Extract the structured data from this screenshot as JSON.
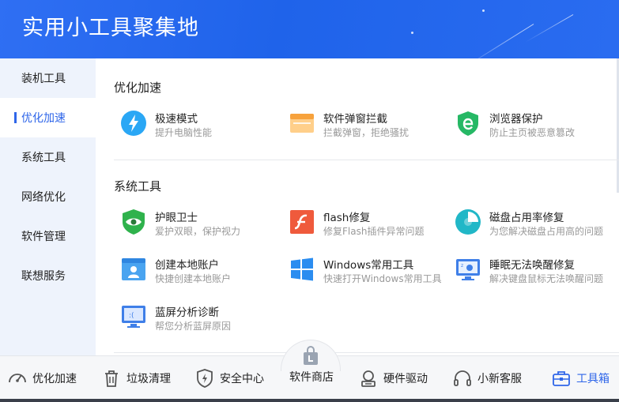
{
  "header": {
    "title": "实用小工具聚集地"
  },
  "sidebar": {
    "items": [
      {
        "label": "装机工具",
        "active": false
      },
      {
        "label": "优化加速",
        "active": true
      },
      {
        "label": "系统工具",
        "active": false
      },
      {
        "label": "网络优化",
        "active": false
      },
      {
        "label": "软件管理",
        "active": false
      },
      {
        "label": "联想服务",
        "active": false
      }
    ]
  },
  "main": {
    "sections": [
      {
        "title": "优化加速",
        "tools": [
          {
            "name": "极速模式",
            "desc": "提升电脑性能",
            "icon": "lightning-icon"
          },
          {
            "name": "软件弹窗拦截",
            "desc": "拦截弹窗，拒绝骚扰",
            "icon": "popup-window-icon"
          },
          {
            "name": "浏览器保护",
            "desc": "防止主页被恶意篡改",
            "icon": "browser-shield-icon"
          }
        ]
      },
      {
        "title": "系统工具",
        "tools": [
          {
            "name": "护眼卫士",
            "desc": "爱护双眼，保护视力",
            "icon": "eye-shield-icon"
          },
          {
            "name": "flash修复",
            "desc": "修复Flash插件异常问题",
            "icon": "flash-icon"
          },
          {
            "name": "磁盘占用率修复",
            "desc": "为您解决磁盘占用高的问题",
            "icon": "disk-pie-icon"
          },
          {
            "name": "创建本地账户",
            "desc": "快捷创建本地账户",
            "icon": "user-account-icon"
          },
          {
            "name": "Windows常用工具",
            "desc": "快速打开Windows常用工具",
            "icon": "windows-logo-icon"
          },
          {
            "name": "睡眠无法唤醒修复",
            "desc": "解决键盘鼠标无法唤醒问题",
            "icon": "sleep-monitor-icon"
          },
          {
            "name": "蓝屏分析诊断",
            "desc": "帮您分析蓝屏原因",
            "icon": "bluescreen-monitor-icon"
          }
        ]
      }
    ]
  },
  "bottom_nav": {
    "items": [
      {
        "label": "优化加速",
        "icon": "speedometer-icon"
      },
      {
        "label": "垃圾清理",
        "icon": "trash-icon"
      },
      {
        "label": "安全中心",
        "icon": "shield-icon"
      },
      {
        "label": "软件商店",
        "icon": "store-bag-icon"
      },
      {
        "label": "硬件驱动",
        "icon": "hardware-icon"
      },
      {
        "label": "小新客服",
        "icon": "headset-icon"
      },
      {
        "label": "工具箱",
        "icon": "toolbox-icon",
        "active": true
      }
    ]
  },
  "colors": {
    "accent": "#2f66e9",
    "header": "#2466ed",
    "sidebar_bg": "#eef3fc"
  }
}
